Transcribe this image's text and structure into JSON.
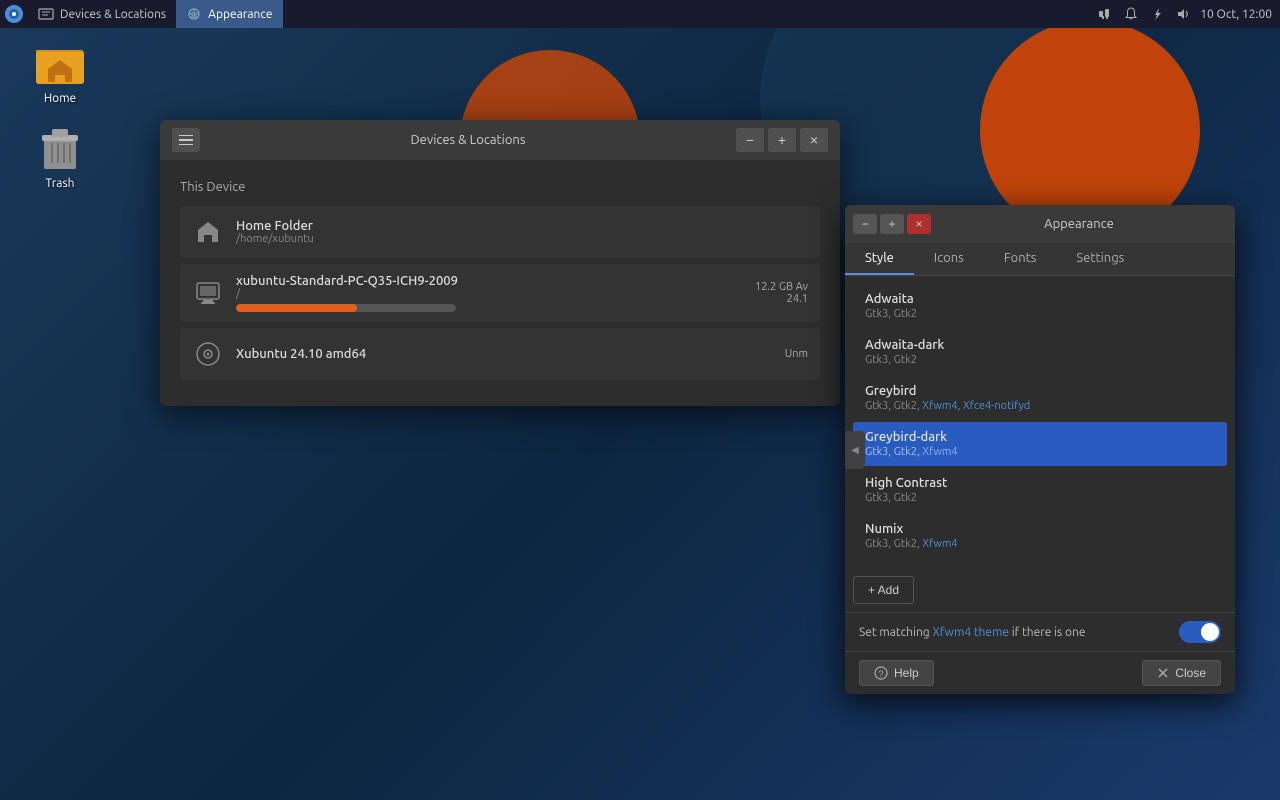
{
  "taskbar": {
    "app1_label": "Devices & Locations",
    "app2_label": "Appearance",
    "time": "10 Oct, 12:00"
  },
  "desktop": {
    "home_icon_label": "Home",
    "trash_icon_label": "Trash"
  },
  "devices_window": {
    "title": "Devices & Locations",
    "section_title": "This Device",
    "items": [
      {
        "name": "Home Folder",
        "path": "/home/xubuntu",
        "type": "home"
      },
      {
        "name": "xubuntu-Standard-PC-Q35-ICH9-2009",
        "path": "/",
        "storage": "12.2 GB Av",
        "storage_sub": "24.1",
        "fill_percent": 55
      },
      {
        "name": "Xubuntu 24.10 amd64",
        "path": "",
        "label": "Unm",
        "type": "disc"
      }
    ],
    "btn_menu": "≡",
    "btn_minimize": "−",
    "btn_maximize": "+",
    "btn_close": "×"
  },
  "appearance_window": {
    "title": "Appearance",
    "tabs": [
      "Style",
      "Icons",
      "Fonts",
      "Settings"
    ],
    "active_tab": "Style",
    "themes": [
      {
        "name": "Adwaita",
        "tags": "Gtk3, Gtk2",
        "selected": false,
        "tag_colors": [
          "normal",
          "normal"
        ]
      },
      {
        "name": "Adwaita-dark",
        "tags": "Gtk3, Gtk2",
        "selected": false,
        "tag_colors": [
          "normal",
          "normal"
        ]
      },
      {
        "name": "Greybird",
        "tags": "Gtk3, Gtk2, Xfwm4, Xfce4-notifyd",
        "selected": false,
        "tag_colors": [
          "normal",
          "normal",
          "blue",
          "blue"
        ]
      },
      {
        "name": "Greybird-dark",
        "tags": "Gtk3, Gtk2, Xfwm4",
        "selected": true,
        "tag_colors": [
          "normal",
          "normal",
          "blue"
        ]
      },
      {
        "name": "High Contrast",
        "tags": "Gtk3, Gtk2",
        "selected": false,
        "tag_colors": [
          "normal",
          "normal"
        ]
      },
      {
        "name": "Numix",
        "tags": "Gtk3, Gtk2, Xfwm4",
        "selected": false,
        "tag_colors": [
          "normal",
          "normal",
          "blue"
        ]
      }
    ],
    "add_label": "+ Add",
    "matching_text_before": "Set matching ",
    "matching_link": "Xfwm4 theme",
    "matching_text_after": " if there is one",
    "help_label": "? Help",
    "close_label": "✕ Close",
    "btn_minimize": "−",
    "btn_maximize": "+",
    "btn_close": "×"
  }
}
